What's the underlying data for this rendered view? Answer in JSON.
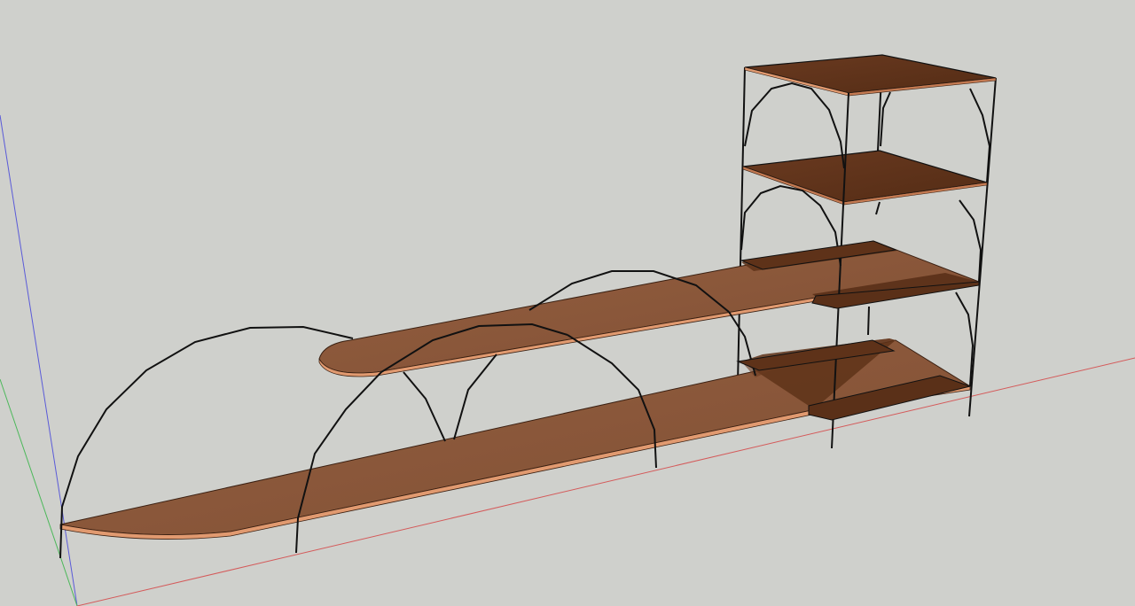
{
  "viewport": {
    "background": "#cfd0cc",
    "mode": "3d-model-view"
  },
  "axes": {
    "red_axis_color": "#d25050",
    "green_axis_color": "#3cb44b",
    "blue_axis_color": "#4b4bd2"
  },
  "materials": {
    "wood_top": "#8a573a",
    "wood_top_light": "#9a6444",
    "wood_dark": "#5e3219",
    "wood_edge": "#e0946a",
    "frame_color": "#111111"
  },
  "model": {
    "parts": [
      "long-lower-shelf",
      "long-upper-shelf",
      "tower-top-shelf",
      "tower-second-shelf",
      "tower-third-shelf",
      "tower-bottom-shelf",
      "arched-frames"
    ]
  }
}
